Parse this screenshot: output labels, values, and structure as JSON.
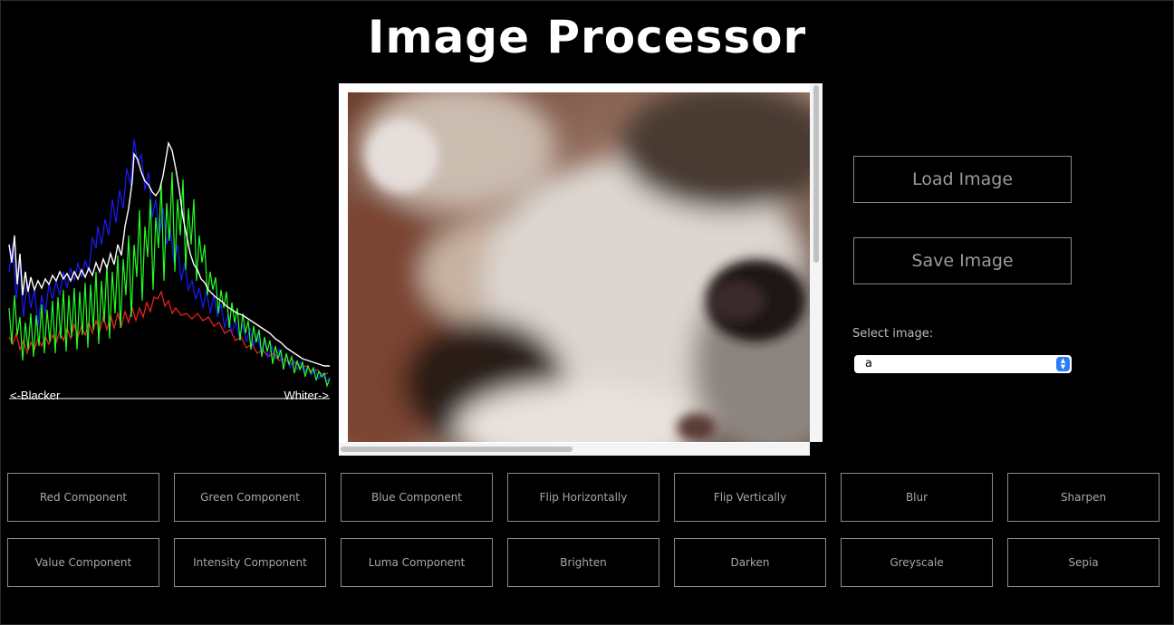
{
  "app": {
    "title": "Image Processor"
  },
  "histogram": {
    "left_label": "<-Blacker",
    "right_label": "Whiter->"
  },
  "controls": {
    "load_label": "Load Image",
    "save_label": "Save Image",
    "select_label": "Select image:",
    "select_value": "a"
  },
  "operations": {
    "row1": [
      "Red Component",
      "Green Component",
      "Blue Component",
      "Flip Horizontally",
      "Flip Vertically",
      "Blur",
      "Sharpen"
    ],
    "row2": [
      "Value Component",
      "Intensity Component",
      "Luma Component",
      "Brighten",
      "Darken",
      "Greyscale",
      "Sepia"
    ]
  },
  "colors": {
    "background": "#000000",
    "red_channel": "#ff2020",
    "green_channel": "#22ff22",
    "blue_channel": "#1a1aff",
    "intensity": "#ffffff",
    "select_accent": "#2a7ef5"
  }
}
